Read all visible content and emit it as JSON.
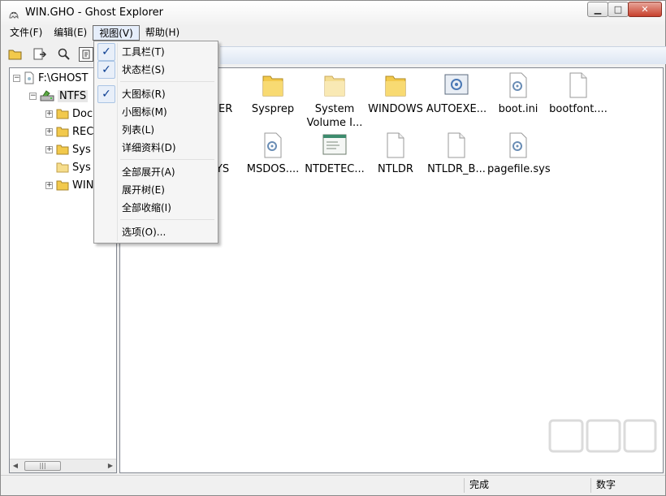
{
  "window": {
    "title": "WIN.GHO - Ghost Explorer"
  },
  "caption": {
    "minimize": "▁",
    "maximize": "□",
    "close": "✕"
  },
  "menubar": {
    "items": [
      {
        "label": "文件(F)"
      },
      {
        "label": "编辑(E)"
      },
      {
        "label": "视图(V)"
      },
      {
        "label": "帮助(H)"
      }
    ]
  },
  "tree": {
    "root": "F:\\GHOST",
    "volume": "NTFS",
    "children": [
      "Doc",
      "REC",
      "Sys",
      "Sys",
      "WIN"
    ]
  },
  "files": [
    {
      "name": "LER",
      "icon": "folder-icon"
    },
    {
      "name": "Sysprep",
      "icon": "folder-icon"
    },
    {
      "name": "System Volume I...",
      "icon": "folder-icon"
    },
    {
      "name": "WINDOWS",
      "icon": "folder-icon"
    },
    {
      "name": "AUTOEXE...",
      "icon": "system-file-icon"
    },
    {
      "name": "boot.ini",
      "icon": "settings-file-icon"
    },
    {
      "name": "bootfont....",
      "icon": "document-icon"
    },
    {
      "name": "YS",
      "icon": "document-icon"
    },
    {
      "name": "MSDOS....",
      "icon": "settings-file-icon"
    },
    {
      "name": "NTDETEC...",
      "icon": "application-icon"
    },
    {
      "name": "NTLDR",
      "icon": "document-icon"
    },
    {
      "name": "NTLDR_B...",
      "icon": "document-icon"
    },
    {
      "name": "pagefile.sys",
      "icon": "settings-file-icon"
    }
  ],
  "view_menu": {
    "items": [
      {
        "label": "工具栏(T)",
        "checked": true
      },
      {
        "label": "状态栏(S)",
        "checked": true
      },
      {
        "label": "大图标(R)",
        "checked": true
      },
      {
        "label": "小图标(M)",
        "checked": false
      },
      {
        "label": "列表(L)",
        "checked": false
      },
      {
        "label": "详细资料(D)",
        "checked": false
      },
      {
        "label": "全部展开(A)",
        "checked": false
      },
      {
        "label": "展开树(E)",
        "checked": false
      },
      {
        "label": "全部收缩(I)",
        "checked": false
      },
      {
        "label": "选项(O)...",
        "checked": false
      }
    ],
    "check_mark": "✓"
  },
  "statusbar": {
    "status": "完成",
    "mode": "数字"
  },
  "colors": {
    "folder": "#f2c94c",
    "accent": "#0b3d91",
    "selection": "#e6eefb"
  }
}
